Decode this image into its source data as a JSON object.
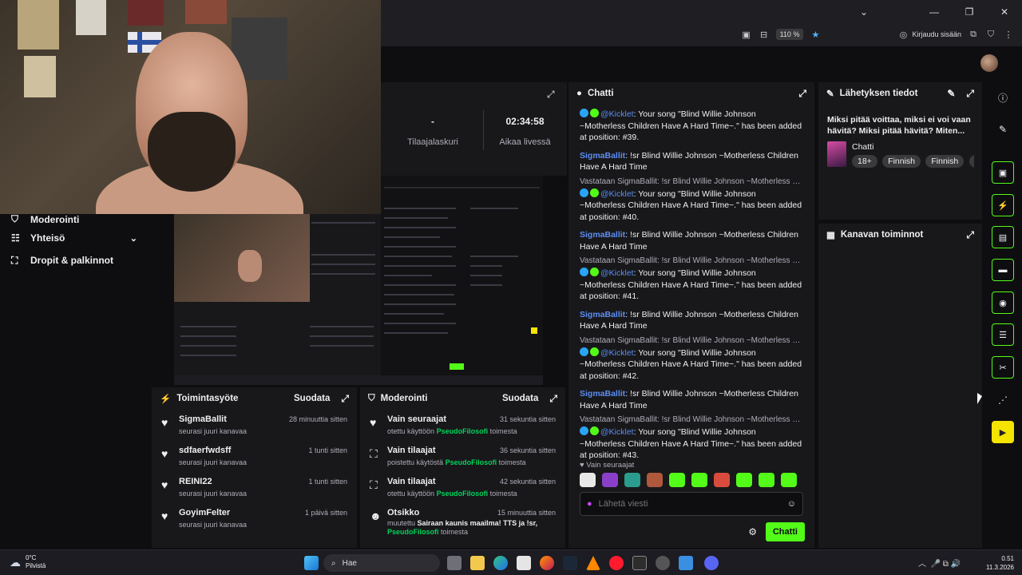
{
  "browser": {
    "zoom": "110 %",
    "login_label": "Kirjaudu sisään"
  },
  "left_nav": {
    "items": [
      {
        "label": "Moderointi"
      },
      {
        "label": "Yhteisö"
      },
      {
        "label": "Dropit & palkinnot"
      }
    ]
  },
  "stats": {
    "subs_value": "-",
    "subs_label": "Tilaajalaskuri",
    "uptime_value": "02:34:58",
    "uptime_label": "Aikaa livessä"
  },
  "activity_feed": {
    "title": "Toimintasyöte",
    "filter": "Suodata",
    "items": [
      {
        "name": "SigmaBallit",
        "time": "28 minuuttia sitten",
        "text": "seurasi juuri kanavaa"
      },
      {
        "name": "sdfaerfwdsff",
        "time": "1 tunti sitten",
        "text": "seurasi juuri kanavaa"
      },
      {
        "name": "REINI22",
        "time": "1 tunti sitten",
        "text": "seurasi juuri kanavaa"
      },
      {
        "name": "GoyimFelter",
        "time": "1 päivä sitten",
        "text": "seurasi juuri kanavaa"
      }
    ]
  },
  "moderation": {
    "title": "Moderointi",
    "filter": "Suodata",
    "items": [
      {
        "name": "Vain seuraajat",
        "time": "31 sekuntia sitten",
        "pre": "otettu käyttöön",
        "user": "PseudoFilosofi",
        "post": "toimesta"
      },
      {
        "name": "Vain tilaajat",
        "time": "36 sekuntia sitten",
        "pre": "poistettu käytöstä",
        "user": "PseudoFilosofi",
        "post": "toimesta"
      },
      {
        "name": "Vain tilaajat",
        "time": "42 sekuntia sitten",
        "pre": "otettu käyttöön",
        "user": "PseudoFilosofi",
        "post": "toimesta"
      },
      {
        "name": "Otsikko",
        "time": "15 minuuttia sitten",
        "pre": "muutettu",
        "bold": "Sairaan kaunis maailma! TTS ja !sr,",
        "user": "PseudoFilosofi",
        "post": "toimesta"
      }
    ]
  },
  "chat": {
    "title": "Chatti",
    "top_text": "Children Have A Hard Time~.\" has been added at position: #39.",
    "messages": [
      {
        "type": "user",
        "user": "SigmaBallit",
        "text": ": !sr Blind Willie Johnson ~Motherless Children Have A Hard Time"
      },
      {
        "type": "reply",
        "reply": "Vastataan SigmaBallit: !sr Blind Willie Johnson ~Motherless Ch...",
        "bot": "@Kicklet",
        "text": ": Your song \"Blind Willie Johnson ~Motherless Children Have A Hard Time~.\" has been added at position: #40."
      },
      {
        "type": "user",
        "user": "SigmaBallit",
        "text": ": !sr Blind Willie Johnson ~Motherless Children Have A Hard Time"
      },
      {
        "type": "reply",
        "reply": "Vastataan SigmaBallit: !sr Blind Willie Johnson ~Motherless Ch...",
        "bot": "@Kicklet",
        "text": ": Your song \"Blind Willie Johnson ~Motherless Children Have A Hard Time~.\" has been added at position: #41."
      },
      {
        "type": "user",
        "user": "SigmaBallit",
        "text": ": !sr Blind Willie Johnson ~Motherless Children Have A Hard Time"
      },
      {
        "type": "reply",
        "reply": "Vastataan SigmaBallit: !sr Blind Willie Johnson ~Motherless Ch...",
        "bot": "@Kicklet",
        "text": ": Your song \"Blind Willie Johnson ~Motherless Children Have A Hard Time~.\" has been added at position: #42."
      },
      {
        "type": "user",
        "user": "SigmaBallit",
        "text": ": !sr Blind Willie Johnson ~Motherless Children Have A Hard Time"
      },
      {
        "type": "reply",
        "reply": "Vastataan SigmaBallit: !sr Blind Willie Johnson ~Motherless Ch...",
        "bot": "@Kicklet",
        "text": ": Your song \"Blind Willie Johnson ~Motherless Children Have A Hard Time~.\" has been added at position: #43."
      }
    ],
    "mode": "Vain seuraajat",
    "input_placeholder": "Lähetä viesti",
    "send_label": "Chatti"
  },
  "stream_info": {
    "title": "Lähetyksen tiedot",
    "stream_title": "Miksi pitää voittaa, miksi ei voi vaan hävitä? Miksi pitää hävitä? Miten...",
    "category": "Chatti",
    "tags": [
      "18+",
      "Finnish",
      "Finnish",
      "K"
    ]
  },
  "channel_actions": {
    "title": "Kanavan toiminnot"
  },
  "taskbar": {
    "weather_temp": "0°C",
    "weather_desc": "Pilvistä",
    "search_label": "Hae",
    "time": "0.51",
    "date": "11.3.2026"
  },
  "colors": {
    "accent": "#53fc18",
    "username": "#5c8ef2",
    "highlight": "#00d45a",
    "panel": "#18181b",
    "background": "#0e0e10"
  }
}
